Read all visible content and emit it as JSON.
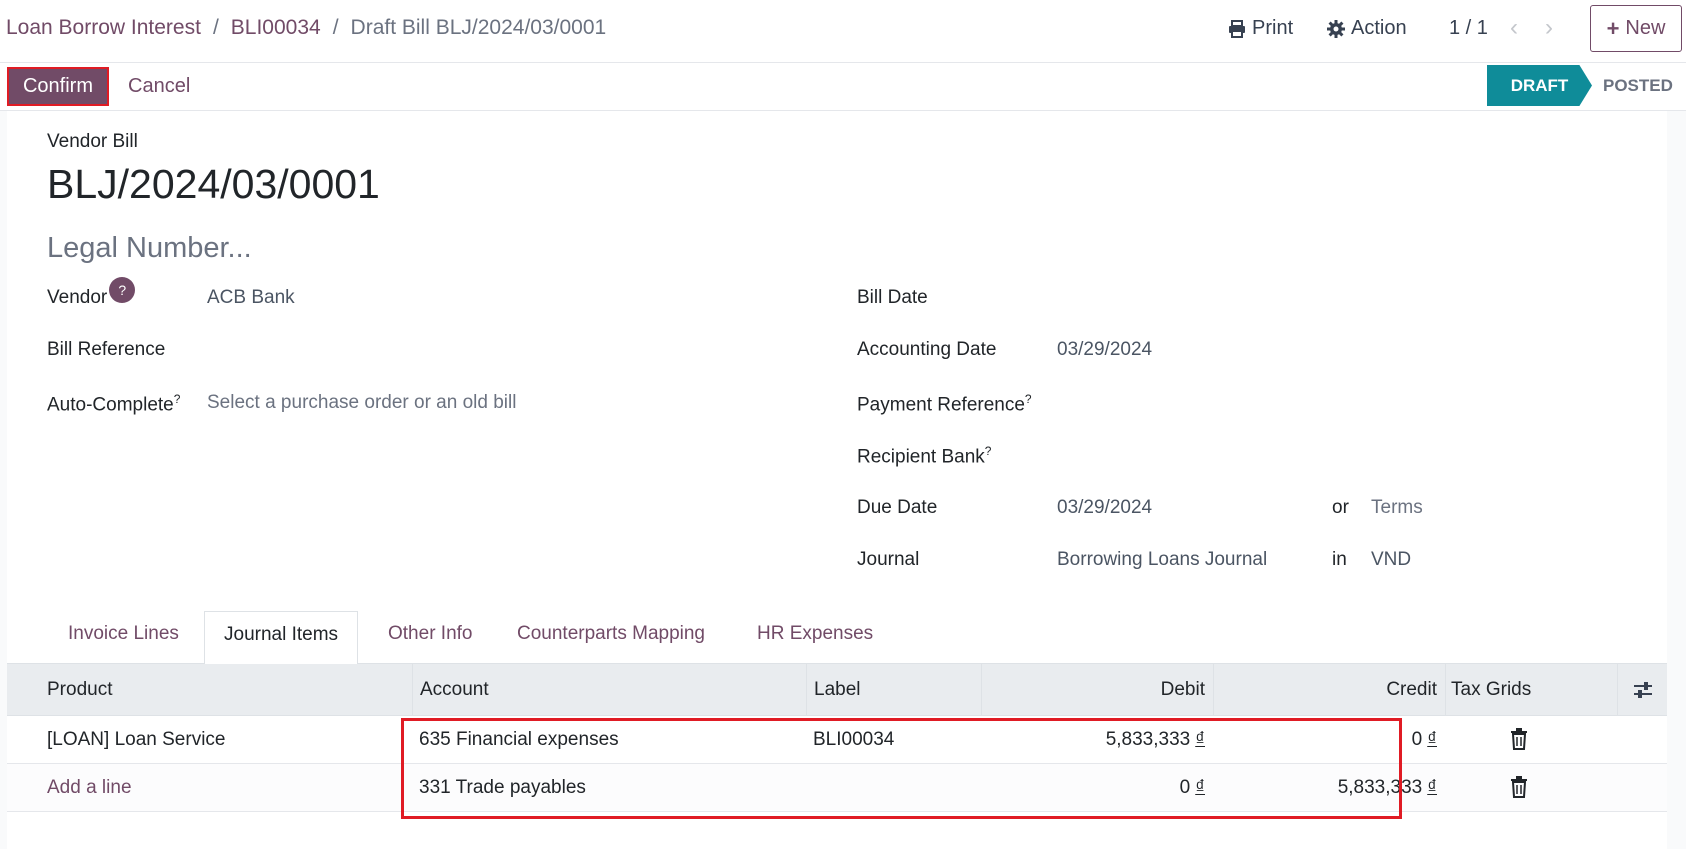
{
  "breadcrumb": {
    "root": "Loan Borrow Interest",
    "parent": "BLI00034",
    "current": "Draft Bill BLJ/2024/03/0001"
  },
  "toolbar": {
    "print_label": "Print",
    "action_label": "Action",
    "pager": "1 / 1",
    "new_label": "New"
  },
  "actions": {
    "confirm_label": "Confirm",
    "cancel_label": "Cancel"
  },
  "status": {
    "draft": "DRAFT",
    "posted": "POSTED",
    "active_color": "#0f8c99"
  },
  "form": {
    "bill_type": "Vendor Bill",
    "bill_number": "BLJ/2024/03/0001",
    "legal_number_placeholder": "Legal Number...",
    "vendor_label": "Vendor",
    "vendor_help": "?",
    "vendor_value": "ACB Bank",
    "bill_reference_label": "Bill Reference",
    "autocomplete_label": "Auto-Complete",
    "autocomplete_placeholder": "Select a purchase order or an old bill",
    "bill_date_label": "Bill Date",
    "accounting_date_label": "Accounting Date",
    "accounting_date_value": "03/29/2024",
    "payment_reference_label": "Payment Reference",
    "recipient_bank_label": "Recipient Bank",
    "due_date_label": "Due Date",
    "due_date_value": "03/29/2024",
    "due_or": "or",
    "terms_placeholder": "Terms",
    "journal_label": "Journal",
    "journal_value": "Borrowing Loans Journal",
    "journal_in": "in",
    "currency": "VND",
    "help_mark": "?"
  },
  "tabs": [
    {
      "label": "Invoice Lines"
    },
    {
      "label": "Journal Items"
    },
    {
      "label": "Other Info"
    },
    {
      "label": "Counterparts Mapping"
    },
    {
      "label": "HR Expenses"
    }
  ],
  "table": {
    "headers": {
      "product": "Product",
      "account": "Account",
      "label": "Label",
      "debit": "Debit",
      "credit": "Credit",
      "tax_grids": "Tax Grids"
    },
    "rows": [
      {
        "product": "[LOAN] Loan Service",
        "account": "635 Financial expenses",
        "label": "BLI00034",
        "debit": "5,833,333",
        "credit": "0"
      },
      {
        "product": "",
        "account": "331 Trade payables",
        "label": "",
        "debit": "0",
        "credit": "5,833,333"
      }
    ],
    "currency_symbol": "₫",
    "add_line": "Add a line"
  },
  "colors": {
    "brand": "#714b67",
    "highlight": "#e01b24"
  }
}
